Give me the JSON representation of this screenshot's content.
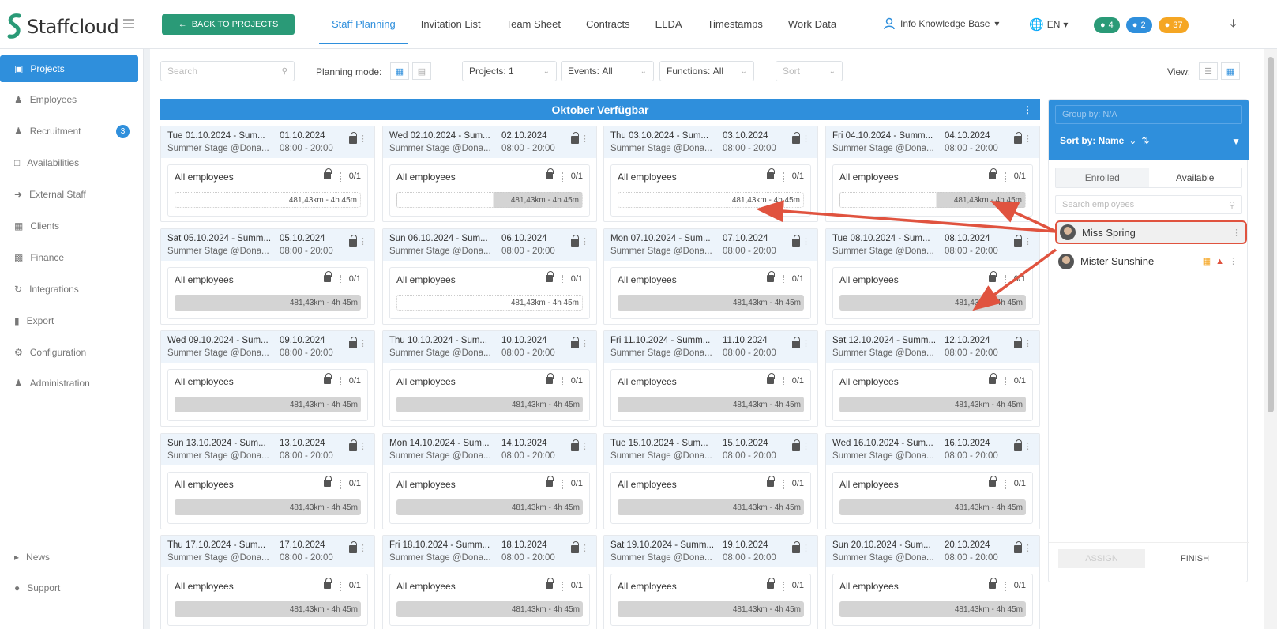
{
  "app": {
    "name": "Staffcloud"
  },
  "header": {
    "back_label": "BACK TO PROJECTS",
    "tabs": [
      {
        "label": "Staff Planning"
      },
      {
        "label": "Invitation List"
      },
      {
        "label": "Team Sheet"
      },
      {
        "label": "Contracts"
      },
      {
        "label": "ELDA"
      },
      {
        "label": "Timestamps"
      },
      {
        "label": "Work Data"
      }
    ],
    "kb_label": "Info Knowledge Base",
    "lang": "EN",
    "badges": [
      {
        "count": "4",
        "color": "#2a9a77",
        "icon": "chat-icon"
      },
      {
        "count": "2",
        "color": "#2f8fdc",
        "icon": "bell-icon"
      },
      {
        "count": "37",
        "color": "#f5a623",
        "icon": "clock-icon"
      }
    ]
  },
  "sidebar": {
    "items": [
      {
        "label": "Projects",
        "icon": "projects-icon"
      },
      {
        "label": "Employees",
        "icon": "employees-icon"
      },
      {
        "label": "Recruitment",
        "icon": "recruitment-icon",
        "badge": "3"
      },
      {
        "label": "Availabilities",
        "icon": "calendar-icon"
      },
      {
        "label": "External Staff",
        "icon": "external-icon"
      },
      {
        "label": "Clients",
        "icon": "building-icon"
      },
      {
        "label": "Finance",
        "icon": "money-icon"
      },
      {
        "label": "Integrations",
        "icon": "sync-icon"
      },
      {
        "label": "Export",
        "icon": "file-icon"
      },
      {
        "label": "Configuration",
        "icon": "gear-icon"
      },
      {
        "label": "Administration",
        "icon": "admin-icon"
      }
    ],
    "bottom": [
      {
        "label": "News",
        "icon": "megaphone-icon"
      },
      {
        "label": "Support",
        "icon": "support-icon"
      }
    ]
  },
  "toolbar": {
    "search_placeholder": "Search",
    "planning_mode_label": "Planning mode:",
    "projects_label": "Projects:",
    "projects_value": "1",
    "events_label": "Events:",
    "events_value": "All",
    "functions_label": "Functions:",
    "functions_value": "All",
    "sort_placeholder": "Sort",
    "view_label": "View:"
  },
  "banner": {
    "title": "Oktober Verfügbar"
  },
  "events": [
    {
      "title": "Tue 01.10.2024 - Sum...",
      "date": "01.10.2024",
      "location": "Summer Stage @Dona...",
      "time": "08:00 - 20:00",
      "fill": "empty"
    },
    {
      "title": "Wed 02.10.2024 - Sum...",
      "date": "02.10.2024",
      "location": "Summer Stage @Dona...",
      "time": "08:00 - 20:00",
      "fill": "partial"
    },
    {
      "title": "Thu 03.10.2024 - Sum...",
      "date": "03.10.2024",
      "location": "Summer Stage @Dona...",
      "time": "08:00 - 20:00",
      "fill": "empty"
    },
    {
      "title": "Fri 04.10.2024 - Summ...",
      "date": "04.10.2024",
      "location": "Summer Stage @Dona...",
      "time": "08:00 - 20:00",
      "fill": "partial"
    },
    {
      "title": "Sat 05.10.2024 - Summ...",
      "date": "05.10.2024",
      "location": "Summer Stage @Dona...",
      "time": "08:00 - 20:00",
      "fill": "full"
    },
    {
      "title": "Sun 06.10.2024 - Sum...",
      "date": "06.10.2024",
      "location": "Summer Stage @Dona...",
      "time": "08:00 - 20:00",
      "fill": "empty"
    },
    {
      "title": "Mon 07.10.2024 - Sum...",
      "date": "07.10.2024",
      "location": "Summer Stage @Dona...",
      "time": "08:00 - 20:00",
      "fill": "full"
    },
    {
      "title": "Tue 08.10.2024 - Sum...",
      "date": "08.10.2024",
      "location": "Summer Stage @Dona...",
      "time": "08:00 - 20:00",
      "fill": "full"
    },
    {
      "title": "Wed 09.10.2024 - Sum...",
      "date": "09.10.2024",
      "location": "Summer Stage @Dona...",
      "time": "08:00 - 20:00",
      "fill": "full"
    },
    {
      "title": "Thu 10.10.2024 - Sum...",
      "date": "10.10.2024",
      "location": "Summer Stage @Dona...",
      "time": "08:00 - 20:00",
      "fill": "full"
    },
    {
      "title": "Fri 11.10.2024 - Summ...",
      "date": "11.10.2024",
      "location": "Summer Stage @Dona...",
      "time": "08:00 - 20:00",
      "fill": "full"
    },
    {
      "title": "Sat 12.10.2024 - Summ...",
      "date": "12.10.2024",
      "location": "Summer Stage @Dona...",
      "time": "08:00 - 20:00",
      "fill": "full"
    },
    {
      "title": "Sun 13.10.2024 - Sum...",
      "date": "13.10.2024",
      "location": "Summer Stage @Dona...",
      "time": "08:00 - 20:00",
      "fill": "full"
    },
    {
      "title": "Mon 14.10.2024 - Sum...",
      "date": "14.10.2024",
      "location": "Summer Stage @Dona...",
      "time": "08:00 - 20:00",
      "fill": "full"
    },
    {
      "title": "Tue 15.10.2024 - Sum...",
      "date": "15.10.2024",
      "location": "Summer Stage @Dona...",
      "time": "08:00 - 20:00",
      "fill": "full"
    },
    {
      "title": "Wed 16.10.2024 - Sum...",
      "date": "16.10.2024",
      "location": "Summer Stage @Dona...",
      "time": "08:00 - 20:00",
      "fill": "full"
    },
    {
      "title": "Thu 17.10.2024 - Sum...",
      "date": "17.10.2024",
      "location": "Summer Stage @Dona...",
      "time": "08:00 - 20:00",
      "fill": "full"
    },
    {
      "title": "Fri 18.10.2024 - Summ...",
      "date": "18.10.2024",
      "location": "Summer Stage @Dona...",
      "time": "08:00 - 20:00",
      "fill": "full"
    },
    {
      "title": "Sat 19.10.2024 - Summ...",
      "date": "19.10.2024",
      "location": "Summer Stage @Dona...",
      "time": "08:00 - 20:00",
      "fill": "full"
    },
    {
      "title": "Sun 20.10.2024 - Sum...",
      "date": "20.10.2024",
      "location": "Summer Stage @Dona...",
      "time": "08:00 - 20:00",
      "fill": "full"
    }
  ],
  "shift": {
    "label": "All employees",
    "count": "0/1",
    "distance": "481,43km - 4h 45m"
  },
  "right_panel": {
    "group_by": "Group by: N/A",
    "sort_label": "Sort by: Name",
    "tabs": [
      {
        "label": "Enrolled"
      },
      {
        "label": "Available"
      }
    ],
    "search_placeholder": "Search employees",
    "employees": [
      {
        "name": "Miss Spring"
      },
      {
        "name": "Mister Sunshine"
      }
    ],
    "assign_label": "ASSIGN",
    "finish_label": "FINISH"
  },
  "colors": {
    "primary": "#2f8fdc",
    "accent_green": "#2a9a77",
    "annotation_red": "#e0533f"
  }
}
